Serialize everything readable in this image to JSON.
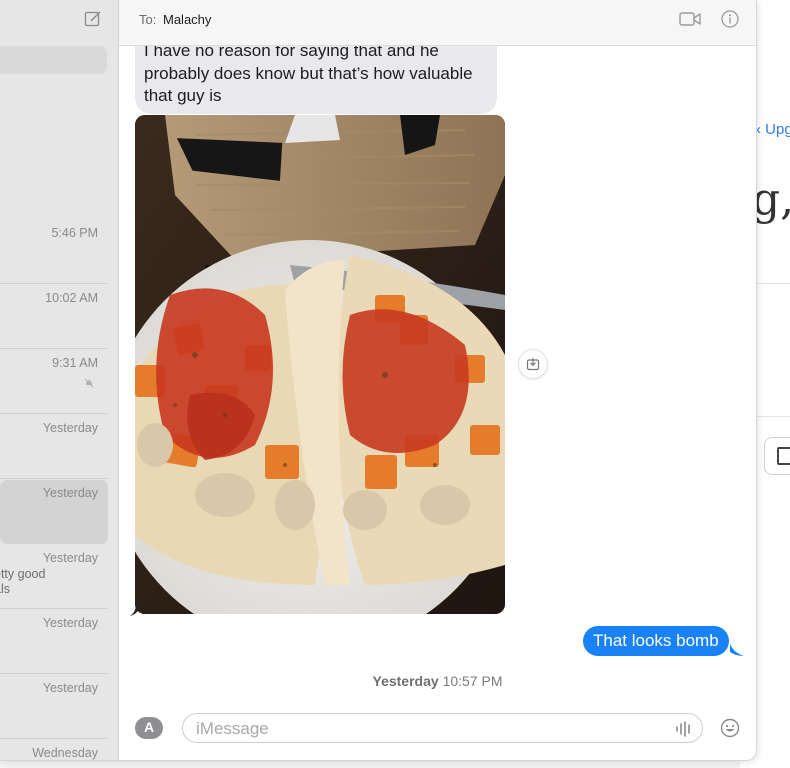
{
  "header": {
    "to_label": "To:",
    "recipient": "Malachy"
  },
  "sidebar": {
    "conversations": [
      {
        "time": "5:46 PM",
        "preview": "",
        "selected": false
      },
      {
        "time": "10:02 AM",
        "preview": "",
        "selected": false
      },
      {
        "time": "9:31 AM",
        "preview": "",
        "selected": false,
        "muted": true
      },
      {
        "time": "Yesterday",
        "preview": "",
        "selected": false
      },
      {
        "time": "Yesterday",
        "preview": "",
        "selected": true
      },
      {
        "time": "Yesterday",
        "preview_line1": "etty good",
        "preview_line2": "als",
        "selected": false
      },
      {
        "time": "Yesterday",
        "preview": "",
        "selected": false
      },
      {
        "time": "Yesterday",
        "preview": "",
        "selected": false
      },
      {
        "time": "Wednesday",
        "preview": "",
        "selected": false
      }
    ]
  },
  "transcript": {
    "received_text": "I have no reason for saying that and he probably does know but that’s how valuable that guy is",
    "sent_text": "That looks bomb",
    "timestamp_day": "Yesterday",
    "timestamp_time": "10:57 PM"
  },
  "compose": {
    "placeholder": "iMessage"
  },
  "background_app": {
    "link_text": "Upg",
    "glyph": "g,"
  },
  "colors": {
    "sent_bubble": "#1a82f7",
    "received_bubble": "#e9e9eb",
    "link": "#2f7ee3"
  }
}
